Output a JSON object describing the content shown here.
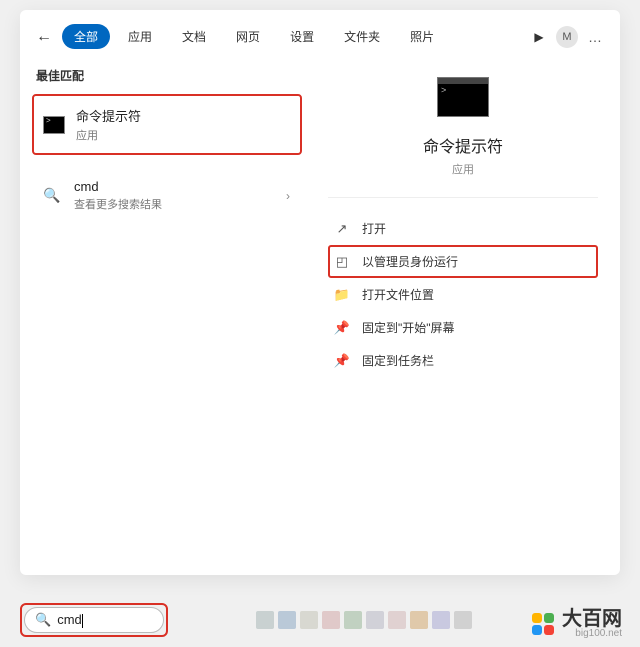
{
  "tabs": {
    "all": "全部",
    "apps": "应用",
    "docs": "文档",
    "web": "网页",
    "settings": "设置",
    "folders": "文件夹",
    "photos": "照片"
  },
  "avatar_initial": "M",
  "left": {
    "best_match_label": "最佳匹配",
    "result1": {
      "title": "命令提示符",
      "sub": "应用"
    },
    "result2": {
      "title": "cmd",
      "sub": "查看更多搜索结果"
    }
  },
  "detail": {
    "title": "命令提示符",
    "sub": "应用"
  },
  "actions": {
    "open": "打开",
    "run_admin": "以管理员身份运行",
    "open_location": "打开文件位置",
    "pin_start": "固定到\"开始\"屏幕",
    "pin_taskbar": "固定到任务栏"
  },
  "searchbox": {
    "value": "cmd"
  },
  "brand": {
    "name": "大百网",
    "domain": "big100.net"
  }
}
